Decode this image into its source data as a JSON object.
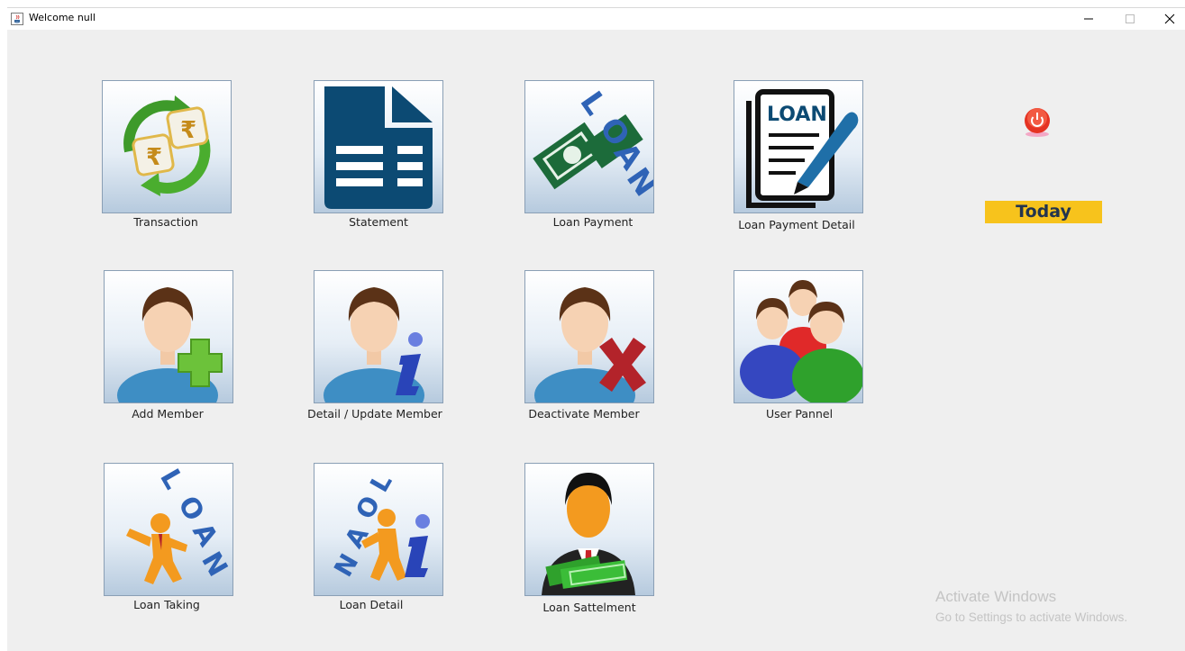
{
  "window": {
    "title": "Welcome null",
    "minimize_icon": "minimize-icon",
    "maximize_icon": "maximize-icon",
    "close_icon": "close-icon"
  },
  "tiles": [
    {
      "label": "Transaction",
      "icon": "rupee-exchange-icon"
    },
    {
      "label": "Statement",
      "icon": "document-icon"
    },
    {
      "label": "Loan Payment",
      "icon": "loan-money-icon"
    },
    {
      "label": "Loan Payment Detail",
      "icon": "loan-document-pen-icon"
    },
    {
      "label": "Add Member",
      "icon": "user-add-icon"
    },
    {
      "label": "Detail / Update Member",
      "icon": "user-info-icon"
    },
    {
      "label": "Deactivate Member",
      "icon": "user-remove-icon"
    },
    {
      "label": "User Pannel",
      "icon": "user-group-icon"
    },
    {
      "label": "Loan Taking",
      "icon": "loan-taking-man-icon"
    },
    {
      "label": "Loan Detail",
      "icon": "loan-detail-man-icon"
    },
    {
      "label": "Loan Sattelment",
      "icon": "businessman-money-icon"
    }
  ],
  "power_icon": "power-icon",
  "today_label": "Today",
  "watermark": {
    "line1": "Activate Windows",
    "line2": "Go to Settings to activate Windows."
  },
  "colors": {
    "today_bg": "#f7c31c",
    "window_bg": "#efefef",
    "power_red": "#e53323"
  }
}
